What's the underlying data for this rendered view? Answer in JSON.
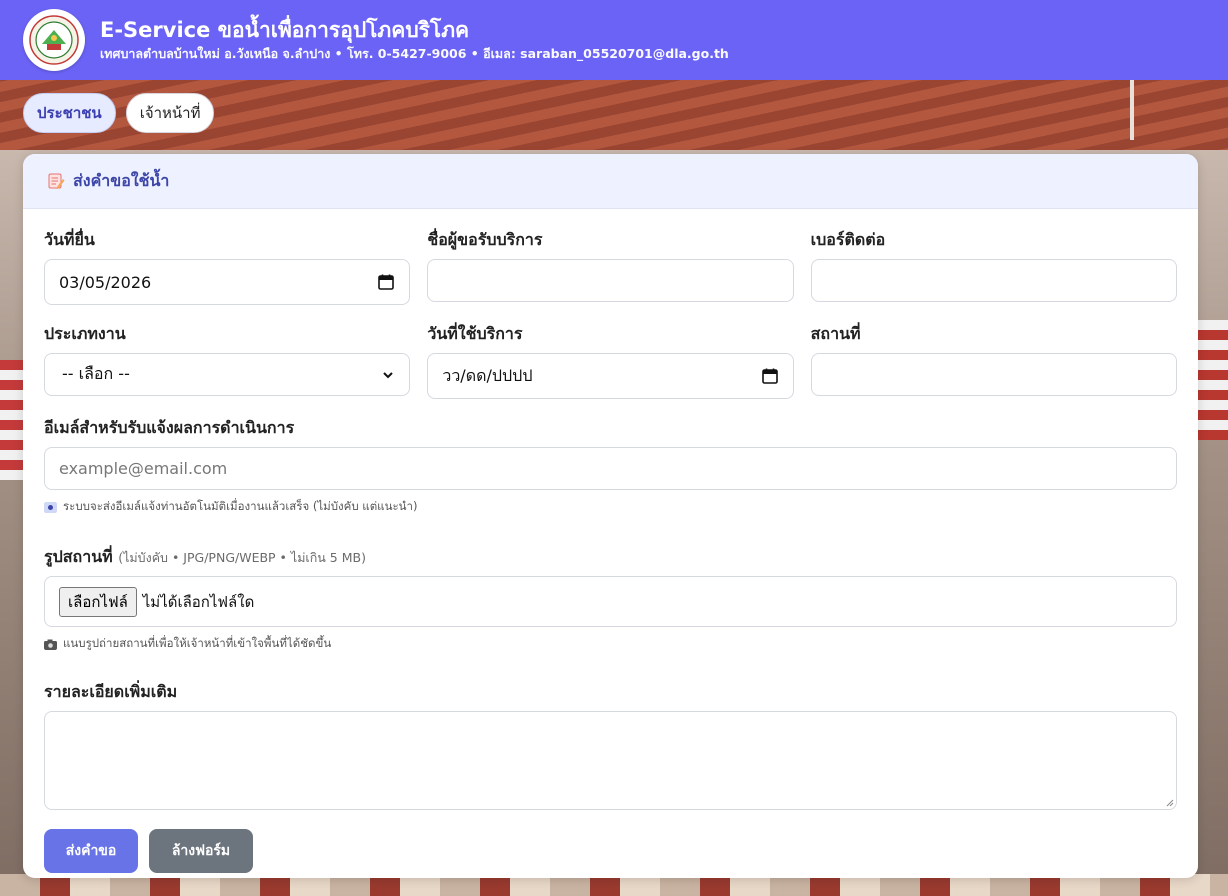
{
  "header": {
    "title": "E-Service ขอน้ำเพื่อการอุปโภคบริโภค",
    "subtitle": "เทศบาลตำบลบ้านใหม่ อ.วังเหนือ จ.ลำปาง • โทร. 0-5427-9006 • อีเมล: saraban_05520701@dla.go.th",
    "logo_icon": "municipality-seal-icon"
  },
  "tabs": [
    {
      "label": "ประชาชน",
      "active": true
    },
    {
      "label": "เจ้าหน้าที่",
      "active": false
    }
  ],
  "form": {
    "title": "ส่งคำขอใช้น้ำ",
    "title_icon": "memo-icon",
    "fields": {
      "submit_date": {
        "label": "วันที่ยื่น",
        "value": "03/05/2026"
      },
      "requester_name": {
        "label": "ชื่อผู้ขอรับบริการ",
        "value": ""
      },
      "phone": {
        "label": "เบอร์ติดต่อ",
        "value": ""
      },
      "work_type": {
        "label": "ประเภทงาน",
        "value": "-- เลือก --"
      },
      "service_date": {
        "label": "วันที่ใช้บริการ",
        "placeholder": "วว/ดด/ปปปป"
      },
      "location": {
        "label": "สถานที่",
        "value": ""
      },
      "email": {
        "label": "อีเมล์สำหรับรับแจ้งผลการดำเนินการ",
        "placeholder": "example@email.com",
        "help": "ระบบจะส่งอีเมล์แจ้งท่านอัตโนมัติเมื่องานแล้วเสร็จ (ไม่บังคับ แต่แนะนำ)"
      },
      "photo": {
        "label": "รูปสถานที่",
        "hint": "(ไม่บังคับ • JPG/PNG/WEBP • ไม่เกิน 5 MB)",
        "button": "เลือกไฟล์",
        "status": "ไม่ได้เลือกไฟล์ใด",
        "help": "แนบรูปถ่ายสถานที่เพื่อให้เจ้าหน้าที่เข้าใจพื้นที่ได้ชัดขึ้น"
      },
      "details": {
        "label": "รายละเอียดเพิ่มเติม",
        "value": ""
      }
    },
    "buttons": {
      "submit": "ส่งคำขอ",
      "reset": "ล้างฟอร์ม"
    }
  },
  "colors": {
    "header_bg": "#6b63f5",
    "primary_button": "#6873e8",
    "secondary_button": "#6c747e",
    "card_header_bg": "#eef1ff",
    "title_accent": "#3d46a8"
  }
}
